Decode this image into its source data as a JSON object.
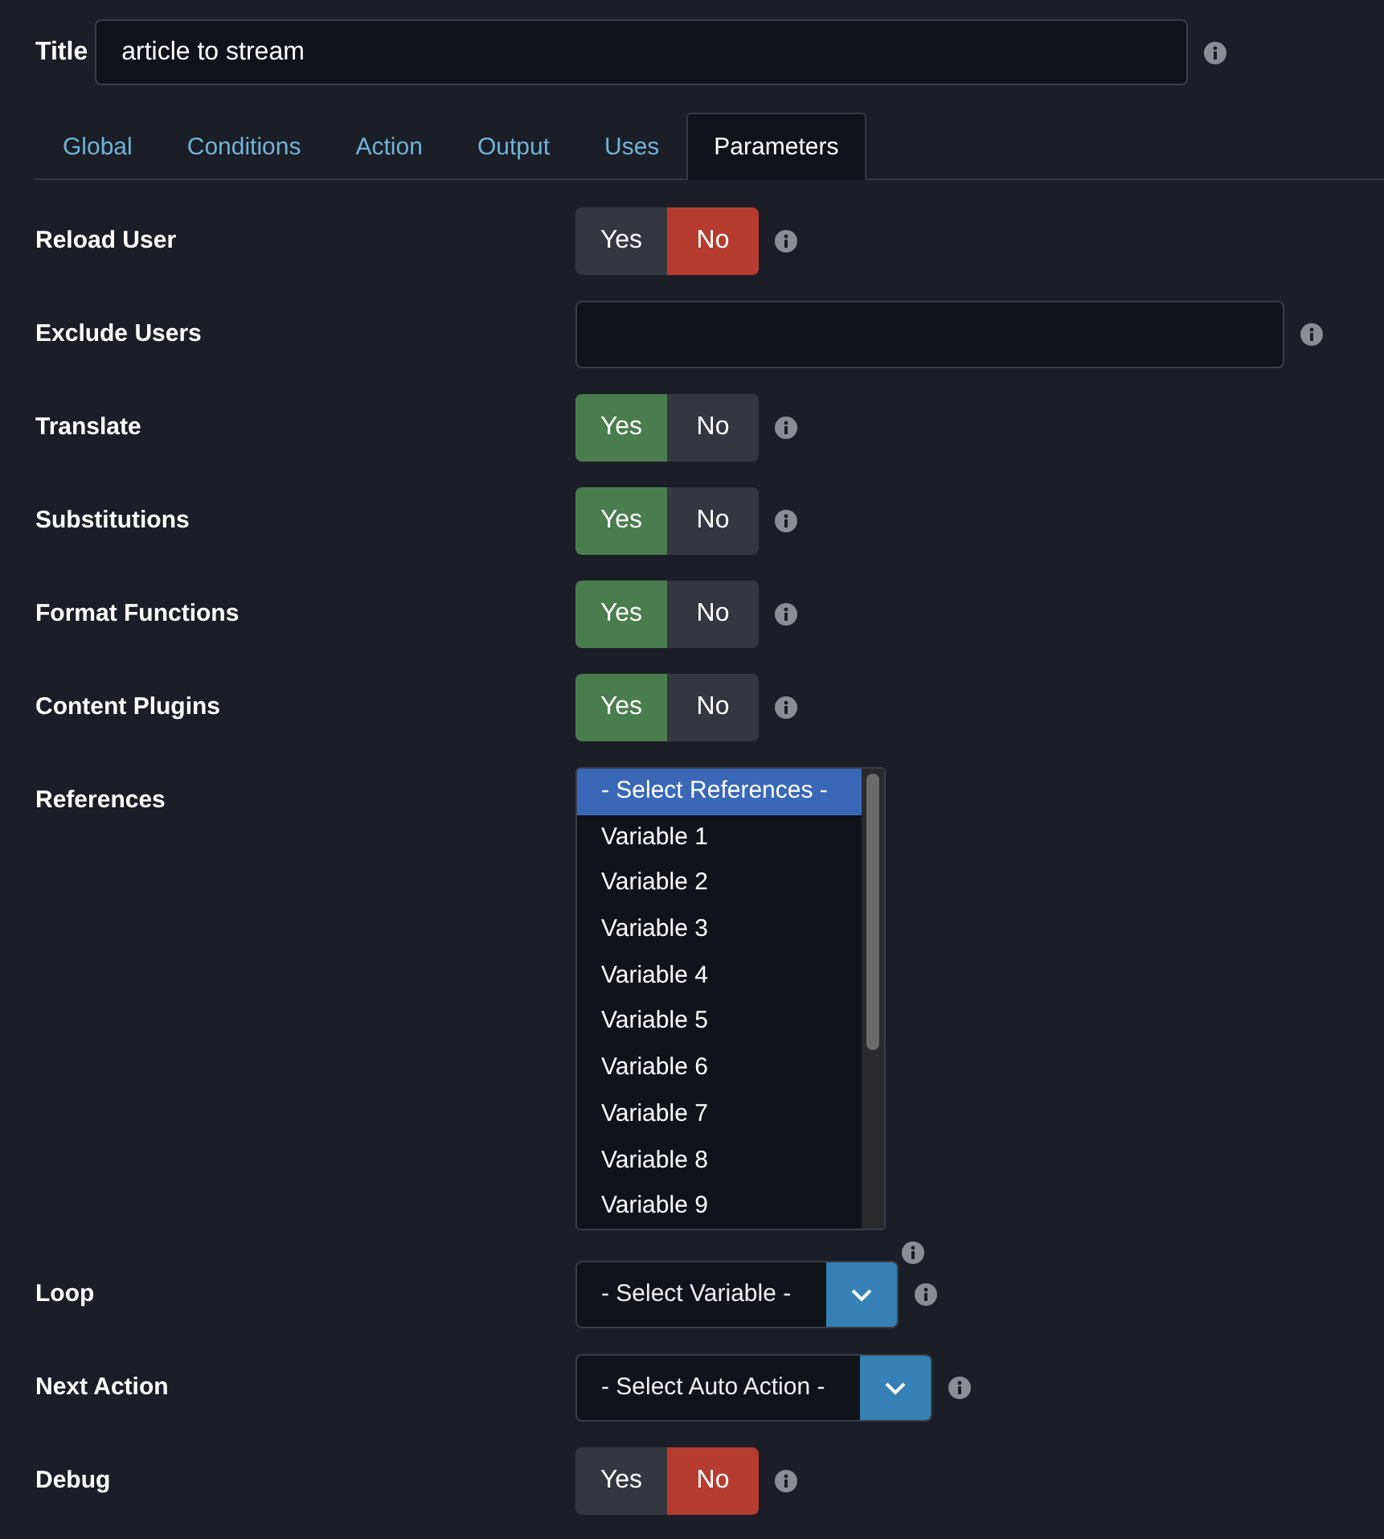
{
  "title": {
    "label": "Title",
    "value": "article to stream"
  },
  "tabs": [
    {
      "label": "Global",
      "selected": false
    },
    {
      "label": "Conditions",
      "selected": false
    },
    {
      "label": "Action",
      "selected": false
    },
    {
      "label": "Output",
      "selected": false
    },
    {
      "label": "Uses",
      "selected": false
    },
    {
      "label": "Parameters",
      "selected": true
    }
  ],
  "fields": [
    {
      "kind": "toggle",
      "label": "Reload User",
      "options": [
        {
          "label": "Yes",
          "selected": false
        },
        {
          "label": "No",
          "selected": true
        }
      ]
    },
    {
      "kind": "text",
      "label": "Exclude Users"
    },
    {
      "kind": "toggle",
      "label": "Translate",
      "options": [
        {
          "label": "Yes",
          "selected": true
        },
        {
          "label": "No",
          "selected": false
        }
      ]
    },
    {
      "kind": "toggle",
      "label": "Substitutions",
      "options": [
        {
          "label": "Yes",
          "selected": true
        },
        {
          "label": "No",
          "selected": false
        }
      ]
    },
    {
      "kind": "toggle",
      "label": "Format Functions",
      "options": [
        {
          "label": "Yes",
          "selected": true
        },
        {
          "label": "No",
          "selected": false
        }
      ]
    },
    {
      "kind": "toggle",
      "label": "Content Plugins",
      "options": [
        {
          "label": "Yes",
          "selected": true
        },
        {
          "label": "No",
          "selected": false
        }
      ]
    },
    {
      "kind": "listbox",
      "label": "References",
      "options": [
        {
          "label": "- Select References -",
          "selected": true
        },
        {
          "label": "Variable 1",
          "selected": false
        },
        {
          "label": "Variable 2",
          "selected": false
        },
        {
          "label": "Variable 3",
          "selected": false
        },
        {
          "label": "Variable 4",
          "selected": false
        },
        {
          "label": "Variable 5",
          "selected": false
        },
        {
          "label": "Variable 6",
          "selected": false
        },
        {
          "label": "Variable 7",
          "selected": false
        },
        {
          "label": "Variable 8",
          "selected": false
        },
        {
          "label": "Variable 9",
          "selected": false
        }
      ]
    },
    {
      "kind": "select",
      "label": "Loop",
      "value": "- Select Variable -"
    },
    {
      "kind": "select",
      "label": "Next Action",
      "value": "- Select Auto Action -"
    },
    {
      "kind": "toggle",
      "label": "Debug",
      "options": [
        {
          "label": "Yes",
          "selected": false
        },
        {
          "label": "No",
          "selected": true
        }
      ]
    }
  ]
}
